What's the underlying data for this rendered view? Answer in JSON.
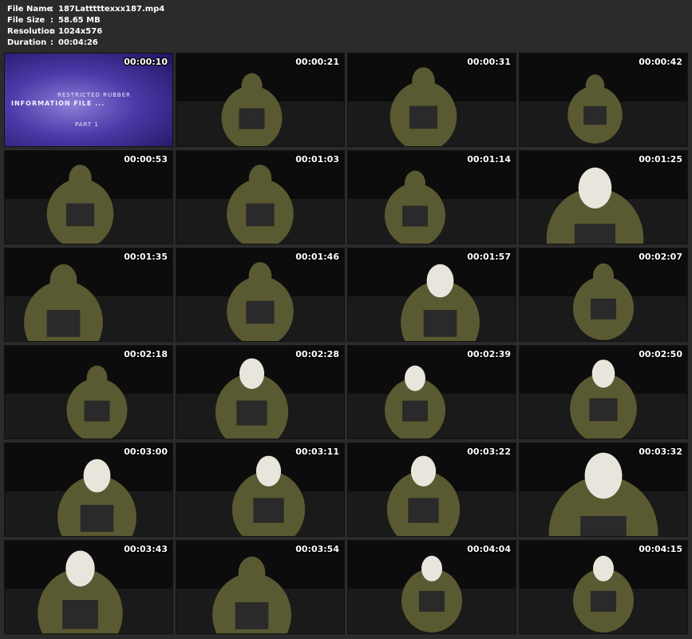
{
  "header": {
    "rows": [
      {
        "label": "File Name",
        "value": "187Latttttexxx187.mp4"
      },
      {
        "label": "File Size",
        "value": "58.65 MB"
      },
      {
        "label": "Resolution",
        "value": "1024x576"
      },
      {
        "label": "Duration",
        "value": "00:04:26"
      }
    ],
    "separator": ":"
  },
  "title_card": {
    "line1": "RESTRICTED RUBBER",
    "line2": "INFORMATION FILE ...",
    "line3": "PART 1"
  },
  "thumbnails": [
    {
      "time": "00:00:10"
    },
    {
      "time": "00:00:21"
    },
    {
      "time": "00:00:31"
    },
    {
      "time": "00:00:42"
    },
    {
      "time": "00:00:53"
    },
    {
      "time": "00:01:03"
    },
    {
      "time": "00:01:14"
    },
    {
      "time": "00:01:25"
    },
    {
      "time": "00:01:35"
    },
    {
      "time": "00:01:46"
    },
    {
      "time": "00:01:57"
    },
    {
      "time": "00:02:07"
    },
    {
      "time": "00:02:18"
    },
    {
      "time": "00:02:28"
    },
    {
      "time": "00:02:39"
    },
    {
      "time": "00:02:50"
    },
    {
      "time": "00:03:00"
    },
    {
      "time": "00:03:11"
    },
    {
      "time": "00:03:22"
    },
    {
      "time": "00:03:32"
    },
    {
      "time": "00:03:43"
    },
    {
      "time": "00:03:54"
    },
    {
      "time": "00:04:04"
    },
    {
      "time": "00:04:15"
    }
  ],
  "colors": {
    "background": "#2b2b2b",
    "text": "#ffffff",
    "scene_dark": "#0c0c0c",
    "scene_olive": "#5a5a32",
    "scene_white": "#e8e6dc"
  }
}
